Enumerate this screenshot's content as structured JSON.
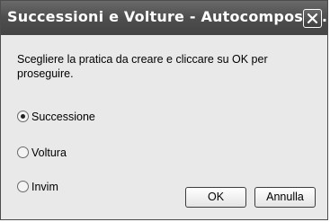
{
  "window": {
    "title": "Successioni e Volture - Autocomposizi...",
    "close_icon": "close-icon"
  },
  "instruction": "Scegliere la pratica da creare e cliccare su  OK per proseguire.",
  "options": [
    {
      "label": "Successione",
      "selected": true
    },
    {
      "label": "Voltura",
      "selected": false
    },
    {
      "label": "Invim",
      "selected": false
    }
  ],
  "buttons": {
    "ok_label": "OK",
    "cancel_label": "Annulla"
  }
}
